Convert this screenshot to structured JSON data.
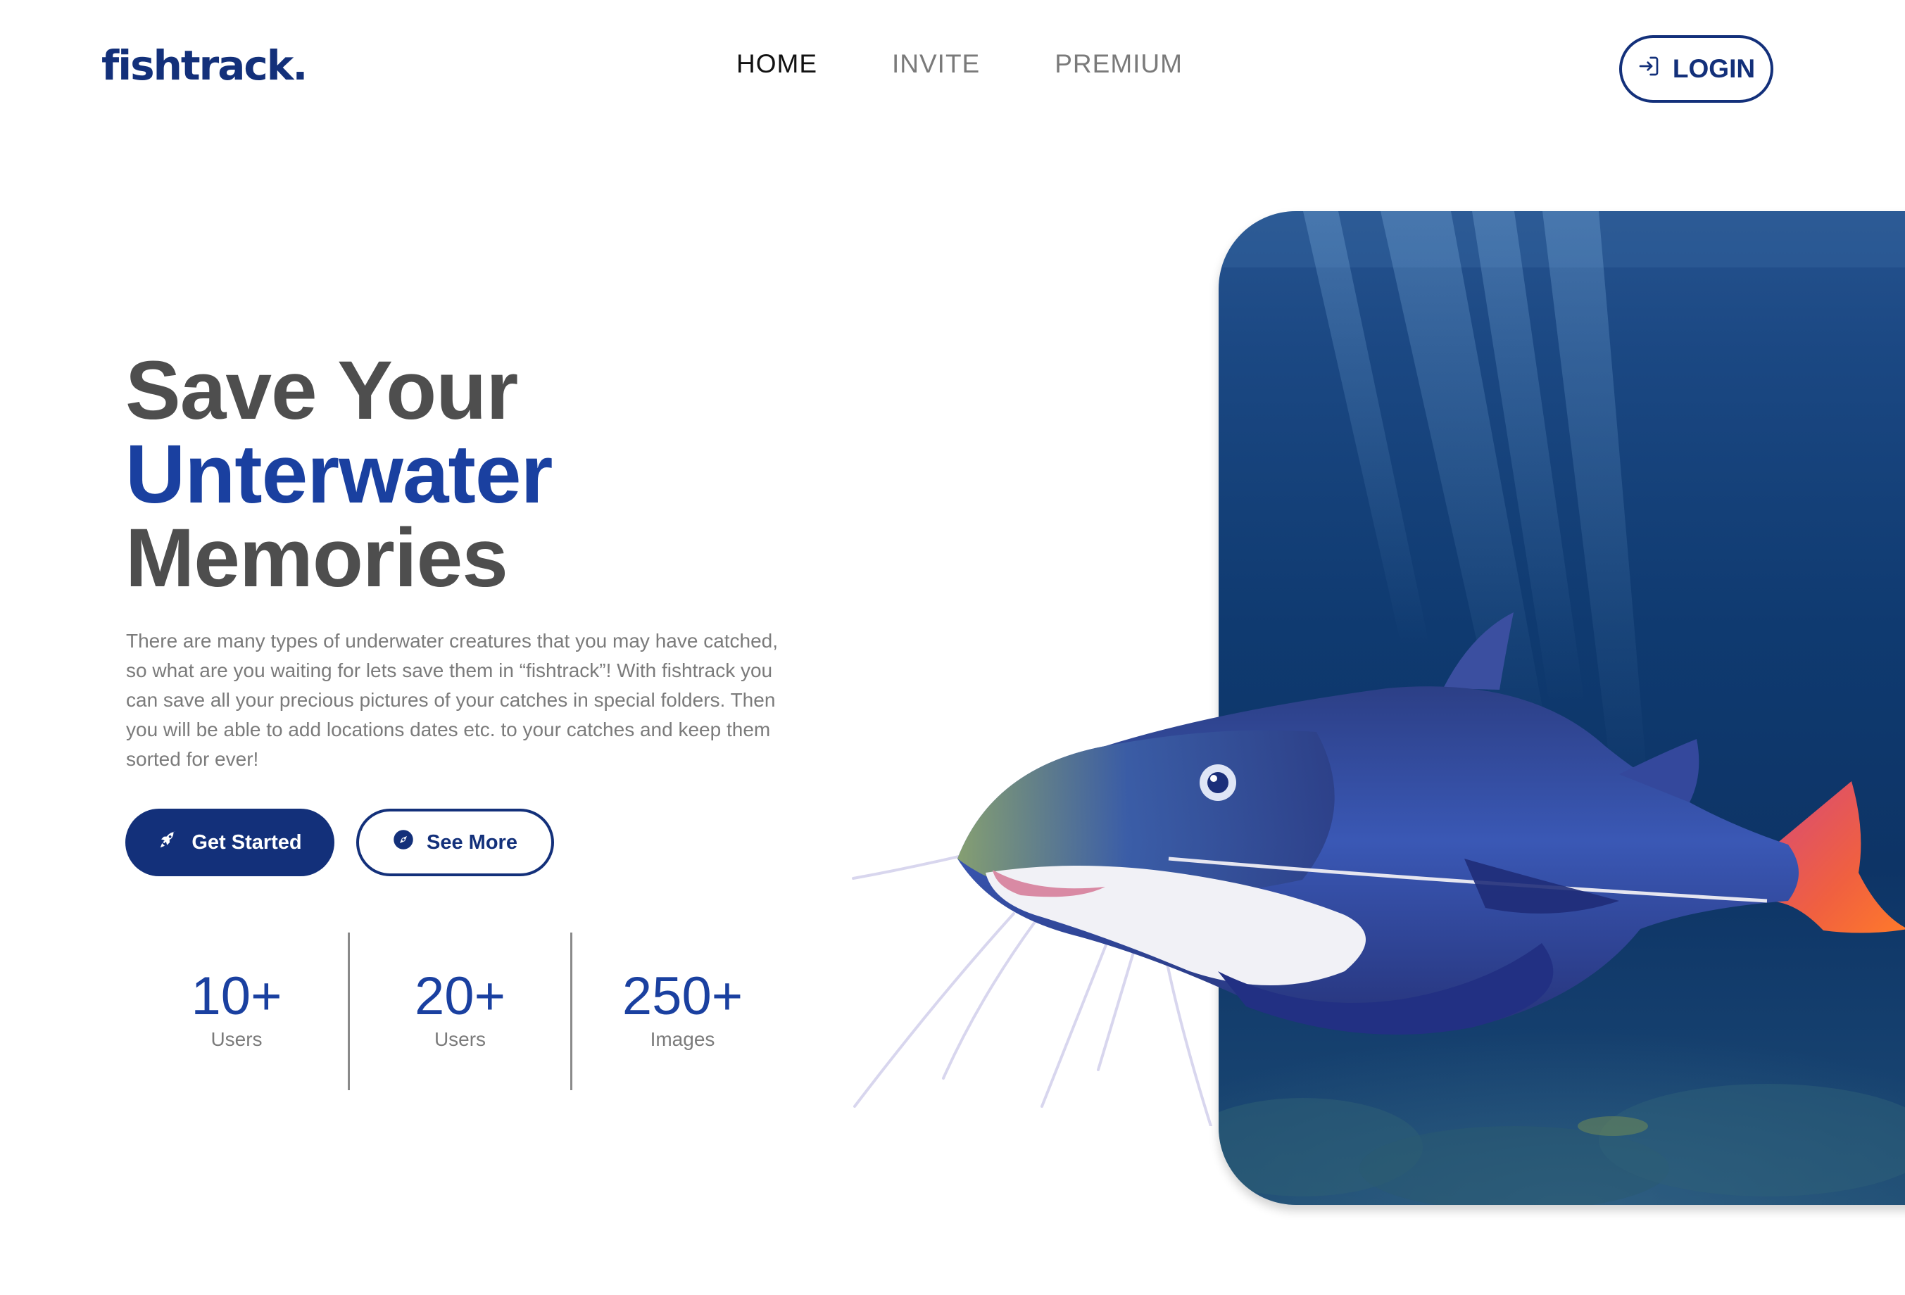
{
  "brand": {
    "logo": "fishtrack."
  },
  "nav": {
    "items": [
      {
        "label": "HOME",
        "active": true
      },
      {
        "label": "INVITE",
        "active": false
      },
      {
        "label": "PREMIUM",
        "active": false
      }
    ]
  },
  "header": {
    "login_label": "LOGIN",
    "login_icon": "login-arrow-icon"
  },
  "hero": {
    "title_line1": "Save Your",
    "title_line2": "Unterwater",
    "title_line3": "Memories",
    "description": "There are many types of underwater creatures that you may have catched, so what are you waiting for lets save them in “fishtrack”! With fishtrack you can save all your precious pictures of your catches in special folders. Then you will be able to add locations dates etc. to your catches and keep them sorted for ever!",
    "primary_button": {
      "label": "Get Started",
      "icon": "rocket-icon"
    },
    "secondary_button": {
      "label": "See More",
      "icon": "compass-icon"
    }
  },
  "stats": [
    {
      "value": "10+",
      "label": "Users"
    },
    {
      "value": "20+",
      "label": "Users"
    },
    {
      "value": "250+",
      "label": "Images"
    }
  ],
  "colors": {
    "brand_navy": "#13307a",
    "accent_blue": "#1a40a0",
    "heading_gray": "#4e4e4e",
    "body_gray": "#7b7b7b"
  }
}
